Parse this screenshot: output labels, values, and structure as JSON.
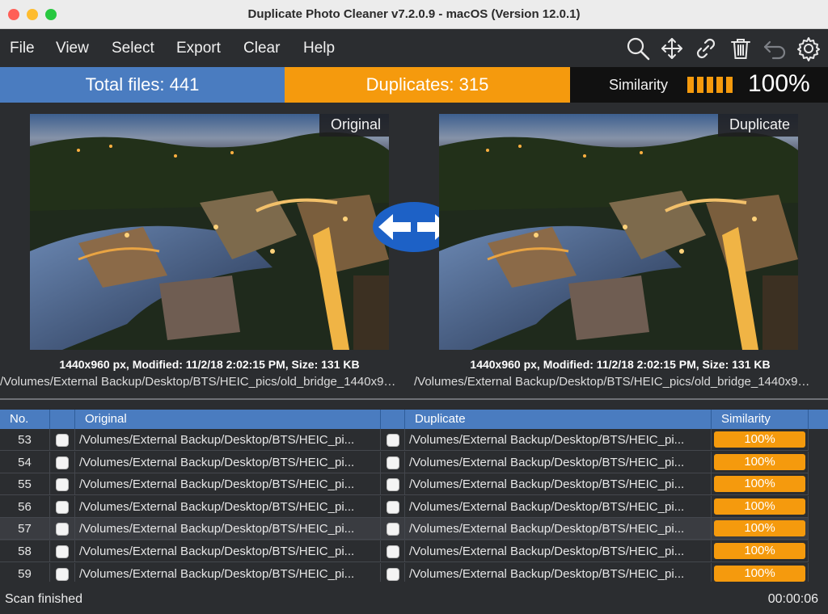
{
  "window": {
    "title": "Duplicate Photo Cleaner v7.2.0.9 - macOS (Version 12.0.1)"
  },
  "menu": [
    "File",
    "View",
    "Select",
    "Export",
    "Clear",
    "Help"
  ],
  "toolbar_icons": [
    "search-icon",
    "move-icon",
    "link-icon",
    "trash-icon",
    "undo-icon",
    "gear-icon"
  ],
  "stats": {
    "total": "Total files: 441",
    "duplicates": "Duplicates: 315",
    "similarity_label": "Similarity",
    "similarity_value": "100%",
    "similarity_level": 1.0
  },
  "preview": {
    "original": {
      "tag": "Original",
      "info": "1440x960 px, Modified: 11/2/18 2:02:15 PM, Size: 131 KB",
      "path": "/Volumes/External Backup/Desktop/BTS/HEIC_pics/old_bridge_1440x9…"
    },
    "duplicate": {
      "tag": "Duplicate",
      "info": "1440x960 px, Modified: 11/2/18 2:02:15 PM, Size: 131 KB",
      "path": "/Volumes/External Backup/Desktop/BTS/HEIC_pics/old_bridge_1440x9…"
    }
  },
  "table": {
    "headers": {
      "no": "No.",
      "original": "Original",
      "duplicate": "Duplicate",
      "similarity": "Similarity"
    },
    "rows": [
      {
        "no": "53",
        "original": "/Volumes/External Backup/Desktop/BTS/HEIC_pi...",
        "duplicate": "/Volumes/External Backup/Desktop/BTS/HEIC_pi...",
        "similarity": "100%"
      },
      {
        "no": "54",
        "original": "/Volumes/External Backup/Desktop/BTS/HEIC_pi...",
        "duplicate": "/Volumes/External Backup/Desktop/BTS/HEIC_pi...",
        "similarity": "100%"
      },
      {
        "no": "55",
        "original": "/Volumes/External Backup/Desktop/BTS/HEIC_pi...",
        "duplicate": "/Volumes/External Backup/Desktop/BTS/HEIC_pi...",
        "similarity": "100%"
      },
      {
        "no": "56",
        "original": "/Volumes/External Backup/Desktop/BTS/HEIC_pi...",
        "duplicate": "/Volumes/External Backup/Desktop/BTS/HEIC_pi...",
        "similarity": "100%"
      },
      {
        "no": "57",
        "original": "/Volumes/External Backup/Desktop/BTS/HEIC_pi...",
        "duplicate": "/Volumes/External Backup/Desktop/BTS/HEIC_pi...",
        "similarity": "100%"
      },
      {
        "no": "58",
        "original": "/Volumes/External Backup/Desktop/BTS/HEIC_pi...",
        "duplicate": "/Volumes/External Backup/Desktop/BTS/HEIC_pi...",
        "similarity": "100%"
      },
      {
        "no": "59",
        "original": "/Volumes/External Backup/Desktop/BTS/HEIC_pi...",
        "duplicate": "/Volumes/External Backup/Desktop/BTS/HEIC_pi...",
        "similarity": "100%"
      }
    ]
  },
  "status": {
    "text": "Scan finished",
    "time": "00:00:06"
  },
  "colors": {
    "accent_blue": "#4a7cc0",
    "accent_orange": "#f59a0d",
    "background": "#2b2d30"
  }
}
